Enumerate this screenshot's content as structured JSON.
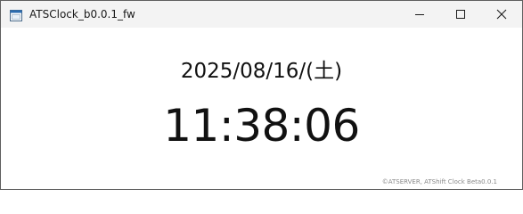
{
  "window": {
    "title": "ATSClock_b0.0.1_fw",
    "controls": {
      "minimize": "minimize-icon",
      "maximize": "maximize-icon",
      "close": "close-icon"
    }
  },
  "clock": {
    "date": "2025/08/16/(土)",
    "time": "11:38:06"
  },
  "footer": {
    "copyright": "©ATSERVER, ATShift Clock Beta0.0.1"
  },
  "colors": {
    "titlebar_bg": "#f3f3f3",
    "window_bg": "#ffffff",
    "text": "#111111",
    "footer_text": "#8a8a8a"
  }
}
